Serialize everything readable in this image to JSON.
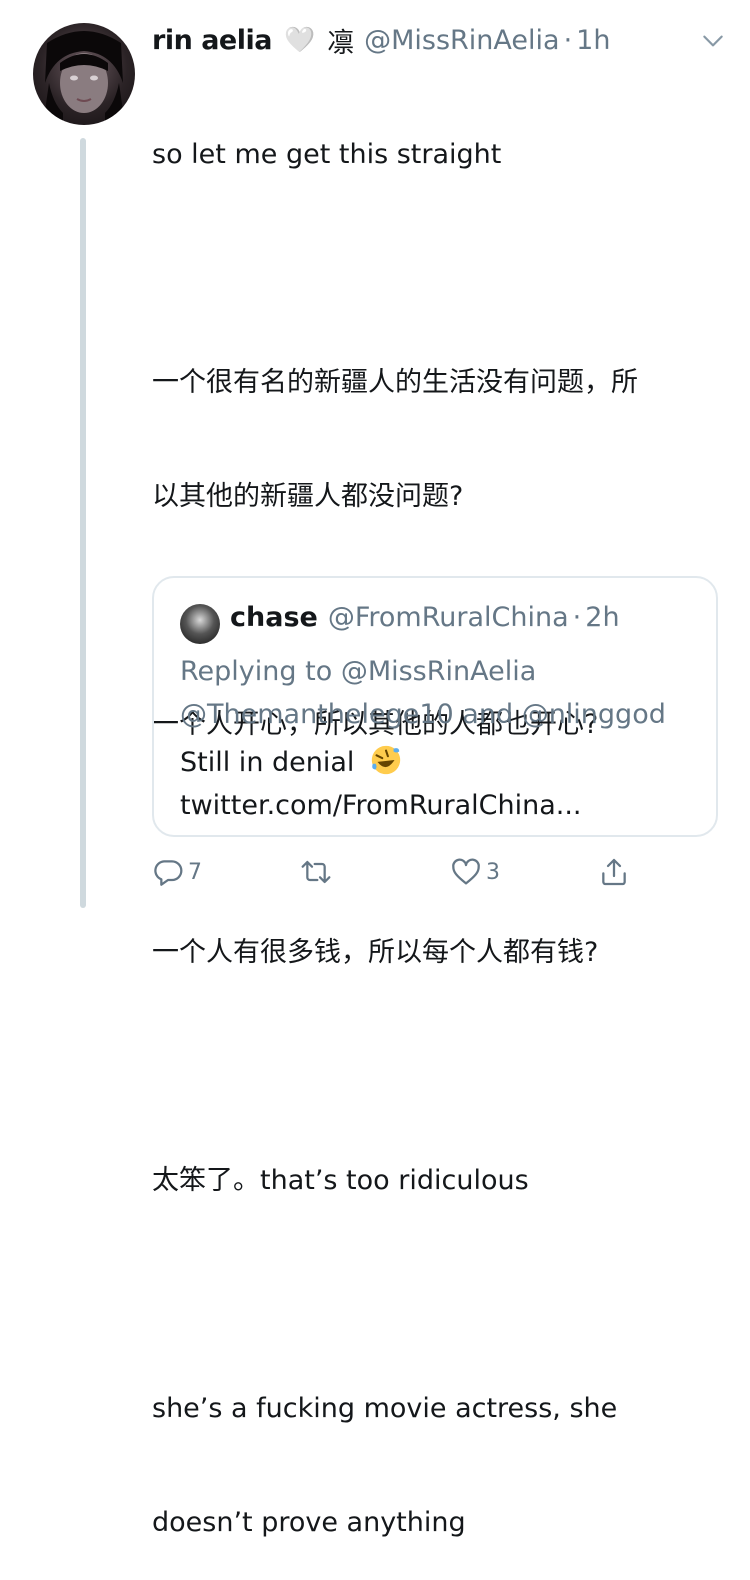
{
  "tweet": {
    "display_name": "rin aelia",
    "name_emoji": "🤍",
    "name_suffix": "凛",
    "handle": "@MissRinAelia",
    "separator": "·",
    "time": "1h",
    "text_lines": [
      "so let me get this straight",
      "",
      "一个很有名的新疆人的生活没有问题，所",
      "以其他的新疆人都没问题?",
      "",
      "一个人开心，所以其他的人都也开心?",
      "",
      "一个人有很多钱，所以每个人都有钱?",
      "",
      "太笨了。that’s too ridiculous",
      "",
      "she’s a fucking movie actress, she",
      "doesn’t prove anything"
    ]
  },
  "quoted": {
    "display_name": "chase",
    "handle": "@FromRuralChina",
    "separator": "·",
    "time": "2h",
    "replying_prefix": "Replying to ",
    "reply_to_1": "@MissRinAelia",
    "reply_to_2": "@Themanthelege10",
    "reply_and": " and ",
    "reply_to_3": "@nlinggod",
    "text": "Still in denial",
    "emoji_name": "rolling-on-floor-laughing",
    "link": "twitter.com/FromRuralChina..."
  },
  "actions": {
    "reply_count": "7",
    "retweet_count": "",
    "like_count": "3"
  },
  "colors": {
    "text": "#14171a",
    "secondary": "#657786",
    "border": "#e1e8ed",
    "thread_line": "#cfd9de"
  },
  "icons": [
    "avatar",
    "chevron-down-icon",
    "reply-icon",
    "retweet-icon",
    "like-icon",
    "share-icon"
  ]
}
